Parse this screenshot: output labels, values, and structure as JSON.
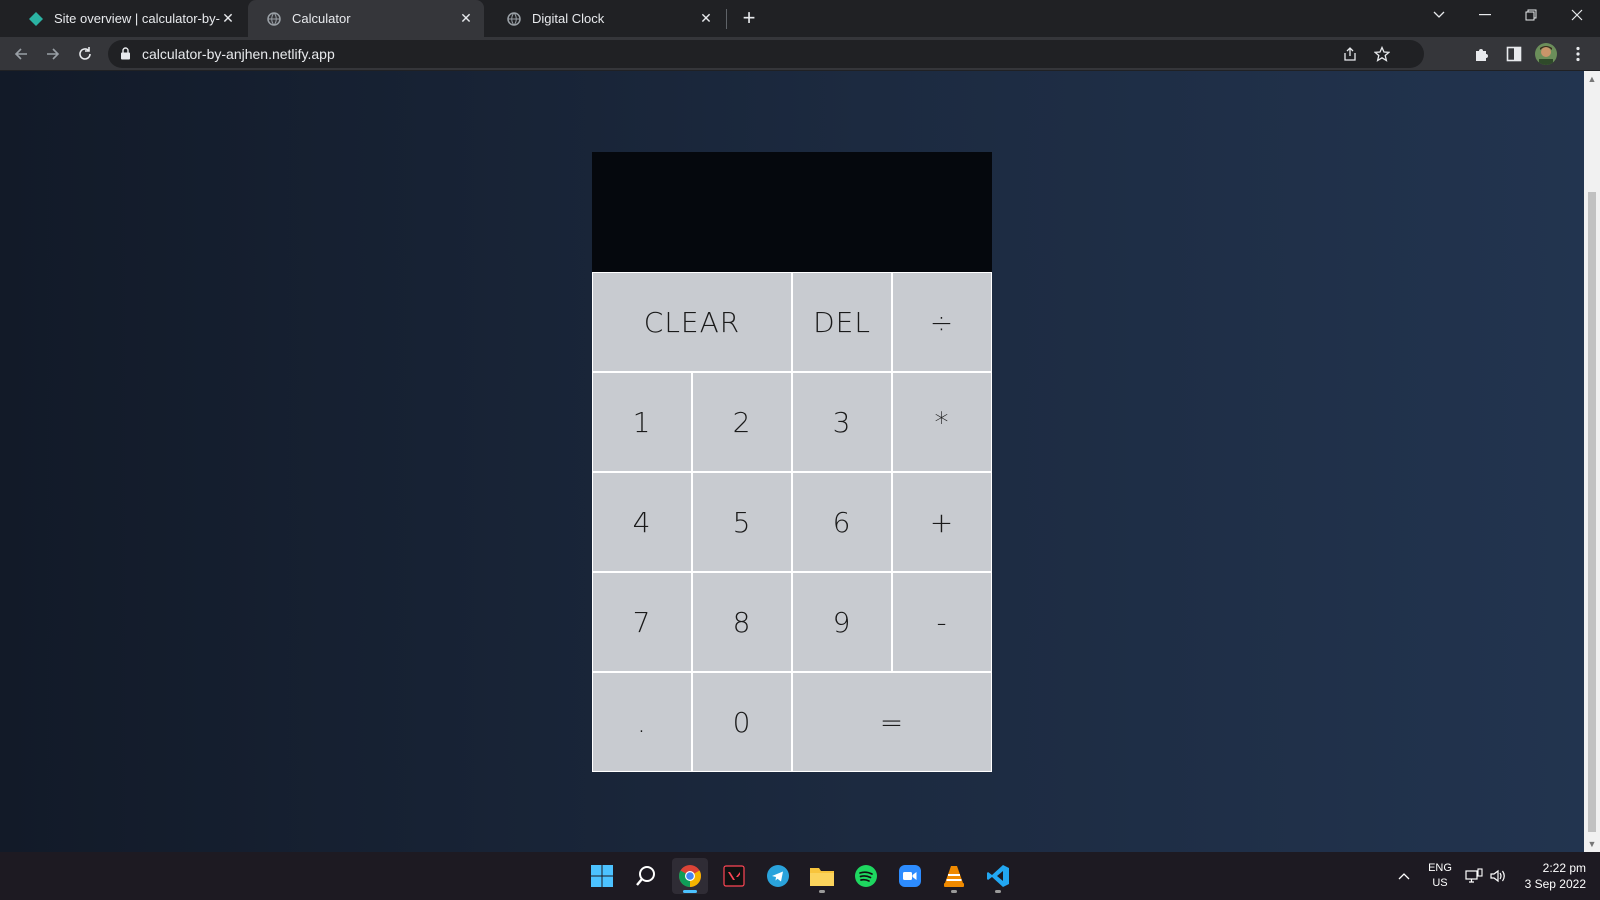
{
  "browser": {
    "tabs": [
      {
        "title": "Site overview | calculator-by-anjh",
        "active": false,
        "favicon": "netlify-diamond-icon"
      },
      {
        "title": "Calculator",
        "active": true,
        "favicon": "globe-icon"
      },
      {
        "title": "Digital Clock",
        "active": false,
        "favicon": "globe-icon"
      }
    ],
    "url": "calculator-by-anjhen.netlify.app"
  },
  "calculator": {
    "display": "",
    "keys": {
      "clear": "CLEAR",
      "del": "DEL",
      "divide": "÷",
      "one": "1",
      "two": "2",
      "three": "3",
      "multiply": "*",
      "four": "4",
      "five": "5",
      "six": "6",
      "add": "+",
      "seven": "7",
      "eight": "8",
      "nine": "9",
      "subtract": "-",
      "decimal": ".",
      "zero": "0",
      "equals": "="
    }
  },
  "taskbar": {
    "apps": [
      "start-icon",
      "search-icon",
      "chrome-icon",
      "valorant-icon",
      "telegram-icon",
      "file-explorer-icon",
      "spotify-icon",
      "zoom-icon",
      "vlc-icon",
      "vscode-icon"
    ],
    "language": {
      "line1": "ENG",
      "line2": "US"
    },
    "time": "2:22 pm",
    "date": "3 Sep 2022"
  },
  "colors": {
    "page_background": "#1c2a40",
    "display_background": "#05080d",
    "key_background": "#c8cbd0",
    "key_border": "#ffffff"
  }
}
